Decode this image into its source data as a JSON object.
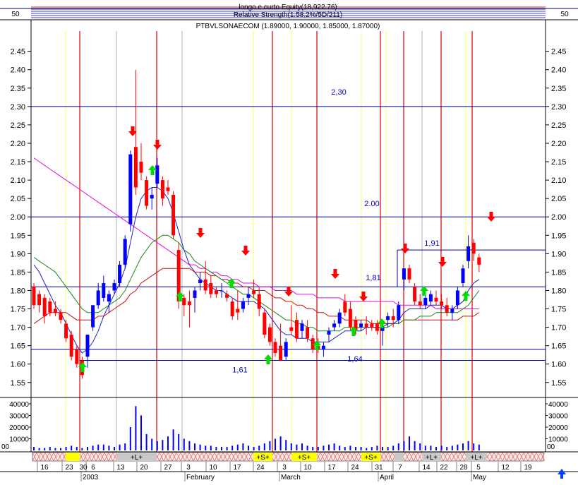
{
  "header": {
    "top_line": "longo e curto Equity(18,922.76)",
    "overlay_line": "Relative Strength(1.58,2%/5D/211)",
    "instrument_line": "PTBVLSONAECOM (1.89000, 1.90000, 1.85000, 1.87000)",
    "top_panel_left_value": "50",
    "top_panel_right_value": "50"
  },
  "chart_data": {
    "type": "candlestick",
    "title": "PTBVLSONAECOM (1.89000, 1.90000, 1.85000, 1.87000)",
    "y_ticks": [
      "2.45",
      "2.40",
      "2.35",
      "2.30",
      "2.25",
      "2.20",
      "2.15",
      "2.10",
      "2.05",
      "2.00",
      "1.95",
      "1.90",
      "1.85",
      "1.80",
      "1.75",
      "1.70",
      "1.65",
      "1.60",
      "1.55"
    ],
    "ylim": [
      1.515,
      2.505
    ],
    "volume_ticks": [
      "40000",
      "30000",
      "20000",
      "10000"
    ],
    "volume_max_label": "00",
    "horizontal_levels": [
      {
        "value": 2.3,
        "label": "2,30"
      },
      {
        "value": 2.0,
        "label": "2.00"
      },
      {
        "value": 1.91,
        "label": "1,91"
      },
      {
        "value": 1.81,
        "label": "1,81"
      },
      {
        "value": 1.64,
        "label": "1,64"
      },
      {
        "value": 1.61,
        "label": "1,61"
      }
    ],
    "x_day_labels": [
      "16",
      "23",
      "30",
      "6",
      "13",
      "20",
      "27",
      "3",
      "10",
      "17",
      "24",
      "3",
      "10",
      "17",
      "24",
      "31",
      "7",
      "14",
      "22",
      "28",
      "5",
      "12",
      "19"
    ],
    "x_month_labels": [
      "2003",
      "February",
      "March",
      "April",
      "May"
    ],
    "signal_labels": [
      "+L+",
      "+S+",
      "+S+",
      "+S+",
      "+L+",
      "+L+"
    ],
    "candles": [
      {
        "o": 1.81,
        "h": 1.82,
        "l": 1.75,
        "c": 1.76
      },
      {
        "o": 1.79,
        "h": 1.8,
        "l": 1.74,
        "c": 1.76
      },
      {
        "o": 1.78,
        "h": 1.79,
        "l": 1.71,
        "c": 1.73
      },
      {
        "o": 1.77,
        "h": 1.78,
        "l": 1.73,
        "c": 1.74
      },
      {
        "o": 1.75,
        "h": 1.77,
        "l": 1.73,
        "c": 1.74
      },
      {
        "o": 1.74,
        "h": 1.75,
        "l": 1.71,
        "c": 1.72
      },
      {
        "o": 1.71,
        "h": 1.72,
        "l": 1.66,
        "c": 1.67
      },
      {
        "o": 1.68,
        "h": 1.69,
        "l": 1.61,
        "c": 1.62
      },
      {
        "o": 1.64,
        "h": 1.65,
        "l": 1.59,
        "c": 1.6
      },
      {
        "o": 1.61,
        "h": 1.62,
        "l": 1.56,
        "c": 1.57
      },
      {
        "o": 1.62,
        "h": 1.68,
        "l": 1.59,
        "c": 1.68
      },
      {
        "o": 1.7,
        "h": 1.76,
        "l": 1.69,
        "c": 1.76
      },
      {
        "o": 1.76,
        "h": 1.82,
        "l": 1.75,
        "c": 1.8
      },
      {
        "o": 1.78,
        "h": 1.84,
        "l": 1.77,
        "c": 1.82
      },
      {
        "o": 1.77,
        "h": 1.8,
        "l": 1.74,
        "c": 1.79
      },
      {
        "o": 1.8,
        "h": 1.83,
        "l": 1.79,
        "c": 1.82
      },
      {
        "o": 1.82,
        "h": 1.88,
        "l": 1.81,
        "c": 1.87
      },
      {
        "o": 1.87,
        "h": 1.95,
        "l": 1.86,
        "c": 1.94
      },
      {
        "o": 1.98,
        "h": 2.18,
        "l": 1.96,
        "c": 2.17
      },
      {
        "o": 2.19,
        "h": 2.4,
        "l": 2.06,
        "c": 2.08
      },
      {
        "o": 2.15,
        "h": 2.2,
        "l": 2.1,
        "c": 2.12
      },
      {
        "o": 2.1,
        "h": 2.11,
        "l": 2.02,
        "c": 2.03
      },
      {
        "o": 2.05,
        "h": 2.08,
        "l": 2.02,
        "c": 2.06
      },
      {
        "o": 2.09,
        "h": 2.16,
        "l": 2.08,
        "c": 2.14
      },
      {
        "o": 2.1,
        "h": 2.11,
        "l": 2.03,
        "c": 2.05
      },
      {
        "o": 2.08,
        "h": 2.1,
        "l": 2.06,
        "c": 2.07
      },
      {
        "o": 2.06,
        "h": 2.07,
        "l": 1.94,
        "c": 1.95
      },
      {
        "o": 1.91,
        "h": 1.93,
        "l": 1.75,
        "c": 1.77
      },
      {
        "o": 1.78,
        "h": 1.79,
        "l": 1.73,
        "c": 1.76
      },
      {
        "o": 1.77,
        "h": 1.8,
        "l": 1.7,
        "c": 1.76
      },
      {
        "o": 1.78,
        "h": 1.81,
        "l": 1.74,
        "c": 1.8
      },
      {
        "o": 1.82,
        "h": 1.85,
        "l": 1.8,
        "c": 1.83
      },
      {
        "o": 1.83,
        "h": 1.88,
        "l": 1.79,
        "c": 1.8
      },
      {
        "o": 1.82,
        "h": 1.84,
        "l": 1.78,
        "c": 1.79
      },
      {
        "o": 1.8,
        "h": 1.81,
        "l": 1.78,
        "c": 1.79
      },
      {
        "o": 1.8,
        "h": 1.82,
        "l": 1.78,
        "c": 1.8
      },
      {
        "o": 1.79,
        "h": 1.8,
        "l": 1.77,
        "c": 1.78
      },
      {
        "o": 1.77,
        "h": 1.78,
        "l": 1.72,
        "c": 1.73
      },
      {
        "o": 1.75,
        "h": 1.8,
        "l": 1.72,
        "c": 1.74
      },
      {
        "o": 1.75,
        "h": 1.78,
        "l": 1.74,
        "c": 1.77
      },
      {
        "o": 1.78,
        "h": 1.81,
        "l": 1.76,
        "c": 1.79
      },
      {
        "o": 1.8,
        "h": 1.83,
        "l": 1.78,
        "c": 1.79
      },
      {
        "o": 1.79,
        "h": 1.81,
        "l": 1.73,
        "c": 1.75
      },
      {
        "o": 1.74,
        "h": 1.75,
        "l": 1.67,
        "c": 1.68
      },
      {
        "o": 1.7,
        "h": 1.71,
        "l": 1.65,
        "c": 1.66
      },
      {
        "o": 1.66,
        "h": 1.67,
        "l": 1.62,
        "c": 1.63
      },
      {
        "o": 1.65,
        "h": 1.71,
        "l": 1.61,
        "c": 1.61
      },
      {
        "o": 1.62,
        "h": 1.67,
        "l": 1.61,
        "c": 1.66
      },
      {
        "o": 1.7,
        "h": 1.76,
        "l": 1.68,
        "c": 1.69
      },
      {
        "o": 1.72,
        "h": 1.74,
        "l": 1.66,
        "c": 1.67
      },
      {
        "o": 1.69,
        "h": 1.72,
        "l": 1.67,
        "c": 1.71
      },
      {
        "o": 1.7,
        "h": 1.72,
        "l": 1.66,
        "c": 1.67
      },
      {
        "o": 1.67,
        "h": 1.68,
        "l": 1.63,
        "c": 1.64
      },
      {
        "o": 1.65,
        "h": 1.67,
        "l": 1.63,
        "c": 1.64
      },
      {
        "o": 1.64,
        "h": 1.66,
        "l": 1.62,
        "c": 1.65
      },
      {
        "o": 1.68,
        "h": 1.7,
        "l": 1.66,
        "c": 1.69
      },
      {
        "o": 1.7,
        "h": 1.72,
        "l": 1.69,
        "c": 1.71
      },
      {
        "o": 1.71,
        "h": 1.75,
        "l": 1.7,
        "c": 1.74
      },
      {
        "o": 1.77,
        "h": 1.79,
        "l": 1.73,
        "c": 1.74
      },
      {
        "o": 1.75,
        "h": 1.77,
        "l": 1.69,
        "c": 1.7
      },
      {
        "o": 1.72,
        "h": 1.73,
        "l": 1.68,
        "c": 1.69
      },
      {
        "o": 1.7,
        "h": 1.72,
        "l": 1.69,
        "c": 1.71
      },
      {
        "o": 1.71,
        "h": 1.73,
        "l": 1.68,
        "c": 1.7
      },
      {
        "o": 1.71,
        "h": 1.72,
        "l": 1.69,
        "c": 1.7
      },
      {
        "o": 1.71,
        "h": 1.72,
        "l": 1.68,
        "c": 1.69
      },
      {
        "o": 1.69,
        "h": 1.71,
        "l": 1.65,
        "c": 1.7
      },
      {
        "o": 1.72,
        "h": 1.74,
        "l": 1.7,
        "c": 1.73
      },
      {
        "o": 1.73,
        "h": 1.75,
        "l": 1.7,
        "c": 1.72
      },
      {
        "o": 1.72,
        "h": 1.77,
        "l": 1.71,
        "c": 1.76
      },
      {
        "o": 1.83,
        "h": 1.86,
        "l": 1.8,
        "c": 1.86
      },
      {
        "o": 1.86,
        "h": 1.87,
        "l": 1.82,
        "c": 1.83
      },
      {
        "o": 1.81,
        "h": 1.82,
        "l": 1.76,
        "c": 1.77
      },
      {
        "o": 1.77,
        "h": 1.79,
        "l": 1.75,
        "c": 1.76
      },
      {
        "o": 1.76,
        "h": 1.79,
        "l": 1.75,
        "c": 1.78
      },
      {
        "o": 1.77,
        "h": 1.8,
        "l": 1.76,
        "c": 1.79
      },
      {
        "o": 1.78,
        "h": 1.8,
        "l": 1.76,
        "c": 1.77
      },
      {
        "o": 1.77,
        "h": 1.79,
        "l": 1.75,
        "c": 1.76
      },
      {
        "o": 1.76,
        "h": 1.78,
        "l": 1.73,
        "c": 1.74
      },
      {
        "o": 1.74,
        "h": 1.76,
        "l": 1.72,
        "c": 1.75
      },
      {
        "o": 1.76,
        "h": 1.81,
        "l": 1.75,
        "c": 1.8
      },
      {
        "o": 1.82,
        "h": 1.87,
        "l": 1.81,
        "c": 1.86
      },
      {
        "o": 1.88,
        "h": 1.95,
        "l": 1.86,
        "c": 1.92
      },
      {
        "o": 1.93,
        "h": 1.94,
        "l": 1.88,
        "c": 1.9
      },
      {
        "o": 1.89,
        "h": 1.9,
        "l": 1.85,
        "c": 1.87
      }
    ],
    "volumes": [
      3,
      2,
      2,
      3,
      2,
      2,
      3,
      4,
      3,
      2,
      3,
      4,
      5,
      5,
      4,
      3,
      5,
      6,
      20,
      38,
      30,
      14,
      10,
      8,
      9,
      12,
      18,
      14,
      10,
      8,
      6,
      5,
      4,
      4,
      3,
      3,
      3,
      4,
      5,
      6,
      4,
      3,
      4,
      6,
      8,
      10,
      12,
      9,
      6,
      5,
      6,
      4,
      3,
      3,
      4,
      5,
      6,
      4,
      3,
      4,
      3,
      3,
      2,
      3,
      4,
      3,
      3,
      4,
      6,
      8,
      12,
      8,
      6,
      4,
      4,
      3,
      4,
      3,
      4,
      5,
      6,
      8,
      6,
      5
    ],
    "ma_blue": [
      1.87,
      1.85,
      1.82,
      1.79,
      1.76,
      1.74,
      1.71,
      1.68,
      1.65,
      1.63,
      1.64,
      1.66,
      1.69,
      1.73,
      1.76,
      1.79,
      1.82,
      1.86,
      1.93,
      2.0,
      2.05,
      2.07,
      2.08,
      2.08,
      2.07,
      2.05,
      2.01,
      1.96,
      1.91,
      1.87,
      1.85,
      1.83,
      1.82,
      1.81,
      1.8,
      1.8,
      1.79,
      1.78,
      1.77,
      1.77,
      1.77,
      1.77,
      1.76,
      1.75,
      1.73,
      1.71,
      1.69,
      1.68,
      1.68,
      1.67,
      1.67,
      1.67,
      1.66,
      1.66,
      1.66,
      1.66,
      1.67,
      1.68,
      1.69,
      1.69,
      1.69,
      1.69,
      1.7,
      1.7,
      1.7,
      1.7,
      1.71,
      1.71,
      1.72,
      1.74,
      1.75,
      1.75,
      1.75,
      1.75,
      1.76,
      1.76,
      1.76,
      1.75,
      1.75,
      1.76,
      1.77,
      1.8,
      1.82,
      1.83
    ],
    "ma_green": [
      1.89,
      1.88,
      1.87,
      1.86,
      1.85,
      1.83,
      1.81,
      1.79,
      1.77,
      1.75,
      1.74,
      1.74,
      1.74,
      1.75,
      1.76,
      1.77,
      1.78,
      1.8,
      1.83,
      1.86,
      1.89,
      1.91,
      1.93,
      1.94,
      1.95,
      1.95,
      1.94,
      1.93,
      1.91,
      1.9,
      1.88,
      1.87,
      1.86,
      1.85,
      1.84,
      1.83,
      1.82,
      1.81,
      1.8,
      1.79,
      1.79,
      1.78,
      1.77,
      1.76,
      1.75,
      1.74,
      1.73,
      1.72,
      1.72,
      1.71,
      1.71,
      1.7,
      1.7,
      1.69,
      1.69,
      1.69,
      1.69,
      1.69,
      1.7,
      1.7,
      1.7,
      1.7,
      1.7,
      1.7,
      1.7,
      1.7,
      1.7,
      1.71,
      1.71,
      1.72,
      1.72,
      1.72,
      1.73,
      1.73,
      1.73,
      1.74,
      1.74,
      1.74,
      1.74,
      1.74,
      1.75,
      1.76,
      1.78,
      1.8
    ],
    "ma_red": [
      1.71,
      1.72,
      1.73,
      1.74,
      1.74,
      1.74,
      1.74,
      1.73,
      1.72,
      1.72,
      1.72,
      1.72,
      1.73,
      1.73,
      1.74,
      1.75,
      1.76,
      1.77,
      1.79,
      1.8,
      1.82,
      1.83,
      1.84,
      1.85,
      1.86,
      1.86,
      1.86,
      1.86,
      1.86,
      1.86,
      1.85,
      1.85,
      1.85,
      1.84,
      1.84,
      1.83,
      1.83,
      1.82,
      1.82,
      1.81,
      1.81,
      1.8,
      1.8,
      1.8,
      1.79,
      1.78,
      1.78,
      1.77,
      1.77,
      1.76,
      1.76,
      1.75,
      1.75,
      1.74,
      1.74,
      1.73,
      1.73,
      1.73,
      1.72,
      1.72,
      1.72,
      1.72,
      1.72,
      1.71,
      1.71,
      1.71,
      1.71,
      1.71,
      1.71,
      1.72,
      1.72,
      1.72,
      1.72,
      1.72,
      1.72,
      1.72,
      1.72,
      1.72,
      1.72,
      1.72,
      1.73,
      1.73,
      1.73,
      1.74
    ],
    "ma_magenta": [
      2.16,
      2.15,
      2.14,
      2.13,
      2.12,
      2.11,
      2.1,
      2.09,
      2.08,
      2.07,
      2.06,
      2.05,
      2.04,
      2.03,
      2.02,
      2.01,
      2.0,
      1.99,
      1.98,
      1.97,
      1.96,
      1.95,
      1.94,
      1.93,
      1.92,
      1.91,
      1.9,
      1.89,
      1.88,
      1.87,
      1.87,
      1.86,
      1.86,
      1.85,
      1.85,
      1.84,
      1.84,
      1.83,
      1.83,
      1.82,
      1.82,
      1.82,
      1.81,
      1.81,
      1.81,
      1.8,
      1.8,
      1.8,
      1.8,
      1.79,
      1.79,
      1.79,
      1.79,
      1.78,
      1.78,
      1.78,
      1.78,
      1.78,
      1.77,
      1.77,
      1.77,
      1.77,
      1.77,
      1.77,
      1.77,
      1.77,
      1.77,
      1.77,
      1.76,
      1.76,
      1.76,
      1.76,
      1.76,
      1.76,
      1.76,
      1.75,
      1.75,
      1.75,
      1.75,
      1.75,
      1.75,
      1.75,
      1.75,
      1.75
    ]
  },
  "colors": {
    "up_candle": "#0000ff",
    "down_candle": "#ff0000",
    "grid_level": "#00009a",
    "ma_blue": "#2020c0",
    "ma_green": "#1a8a1a",
    "ma_red": "#d01010",
    "ma_magenta": "#e010e0",
    "vline_red": "#e00000",
    "vline_yellow": "#ffff60",
    "vline_gray": "#b0b0b0",
    "signal_long": "#c8c8c8",
    "signal_short": "#ffff00"
  }
}
